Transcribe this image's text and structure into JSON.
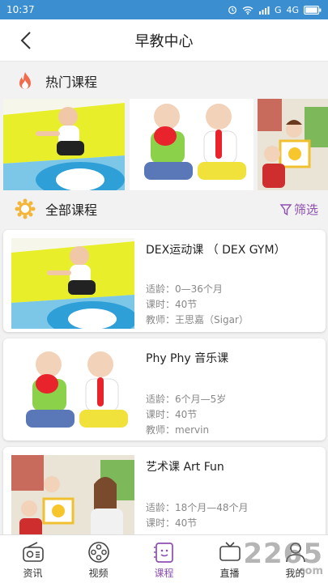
{
  "status": {
    "time": "10:37",
    "network": "4G",
    "carrier": "G"
  },
  "header": {
    "title": "早教中心",
    "back_icon": "chevron-left-icon"
  },
  "hot_section": {
    "title": "热门课程",
    "icon": "flame-icon",
    "accent": "#f26b4a"
  },
  "all_section": {
    "title": "全部课程",
    "icon": "sun-badge-icon",
    "filter_label": "筛选",
    "accent": "#8e4fb0"
  },
  "courses": [
    {
      "title": "DEX运动课 （ DEX GYM）",
      "age": "适龄：0—36个月",
      "hours": "课时：40节",
      "teacher": "教师：王思嘉（Sigar）"
    },
    {
      "title": "Phy Phy 音乐课",
      "age": "适龄：6个月—5岁",
      "hours": "课时：40节",
      "teacher": "教师：mervin"
    },
    {
      "title": "艺术课 Art Fun",
      "age": "适龄：18个月—48个月",
      "hours": "课时：40节",
      "teacher": ""
    }
  ],
  "tabs": [
    {
      "label": "资讯",
      "icon": "radio-icon",
      "active": false
    },
    {
      "label": "视频",
      "icon": "film-reel-icon",
      "active": false
    },
    {
      "label": "课程",
      "icon": "course-book-icon",
      "active": true
    },
    {
      "label": "直播",
      "icon": "tv-icon",
      "active": false
    },
    {
      "label": "我的",
      "icon": "user-icon",
      "active": false
    }
  ],
  "watermark": {
    "text": "2265",
    "sub": ".com"
  },
  "colors": {
    "status_bar": "#3b8fd1",
    "active_tab": "#8e4fb0"
  }
}
